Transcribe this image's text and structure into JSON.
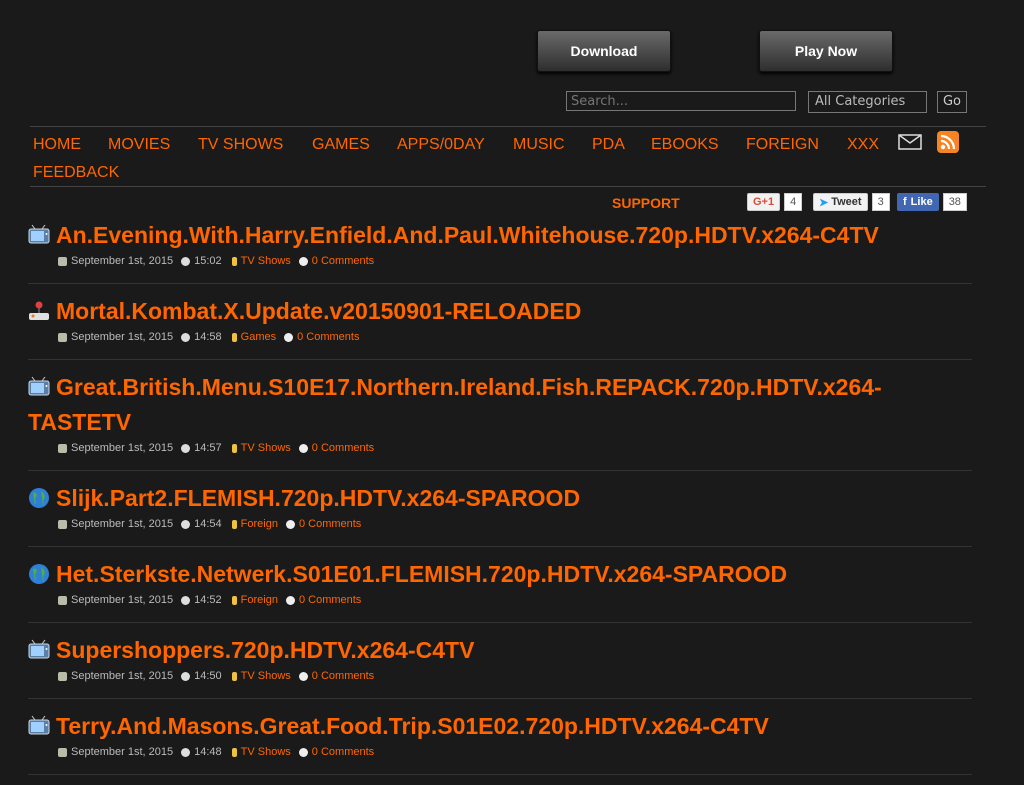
{
  "header": {
    "download_label": "Download",
    "play_label": "Play Now"
  },
  "search": {
    "placeholder": "Search...",
    "category": "All Categories",
    "go_label": "Go"
  },
  "nav": {
    "items": [
      "HOME",
      "MOVIES",
      "TV SHOWS",
      "GAMES",
      "APPS/0DAY",
      "MUSIC",
      "PDA",
      "EBOOKS",
      "FOREIGN",
      "XXX",
      "FEEDBACK"
    ],
    "support": "SUPPORT"
  },
  "social": {
    "gplus_label": "G+1",
    "gplus_count": "4",
    "tweet_label": "Tweet",
    "tweet_count": "3",
    "like_label": "Like",
    "like_count": "38"
  },
  "posts": [
    {
      "title": "An.Evening.With.Harry.Enfield.And.Paul.Whitehouse.720p.HDTV.x264-C4TV",
      "date": "September 1st, 2015",
      "time": "15:02",
      "category": "TV Shows",
      "comments": "0 Comments",
      "icon": "tv-icon"
    },
    {
      "title": "Mortal.Kombat.X.Update.v20150901-RELOADED",
      "date": "September 1st, 2015",
      "time": "14:58",
      "category": "Games",
      "comments": "0 Comments",
      "icon": "joystick-icon"
    },
    {
      "title": "Great.British.Menu.S10E17.Northern.Ireland.Fish.REPACK.720p.HDTV.x264-TASTETV",
      "date": "September 1st, 2015",
      "time": "14:57",
      "category": "TV Shows",
      "comments": "0 Comments",
      "icon": "tv-icon"
    },
    {
      "title": "Slijk.Part2.FLEMISH.720p.HDTV.x264-SPAROOD",
      "date": "September 1st, 2015",
      "time": "14:54",
      "category": "Foreign",
      "comments": "0 Comments",
      "icon": "globe-icon"
    },
    {
      "title": "Het.Sterkste.Netwerk.S01E01.FLEMISH.720p.HDTV.x264-SPAROOD",
      "date": "September 1st, 2015",
      "time": "14:52",
      "category": "Foreign",
      "comments": "0 Comments",
      "icon": "globe-icon"
    },
    {
      "title": "Supershoppers.720p.HDTV.x264-C4TV",
      "date": "September 1st, 2015",
      "time": "14:50",
      "category": "TV Shows",
      "comments": "0 Comments",
      "icon": "tv-icon"
    },
    {
      "title": "Terry.And.Masons.Great.Food.Trip.S01E02.720p.HDTV.x264-C4TV",
      "date": "September 1st, 2015",
      "time": "14:48",
      "category": "TV Shows",
      "comments": "0 Comments",
      "icon": "tv-icon"
    }
  ]
}
